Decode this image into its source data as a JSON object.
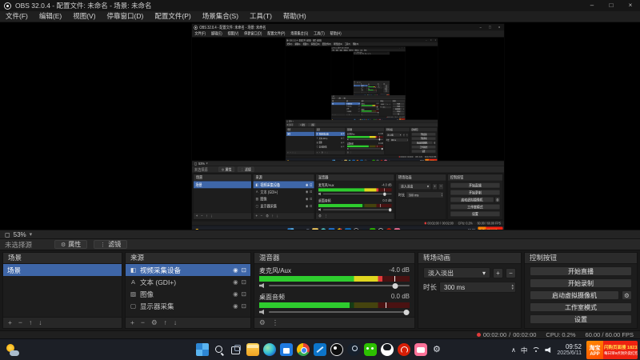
{
  "titlebar": {
    "title": "OBS 32.0.4 - 配置文件: 未命名 - 场景: 未命名"
  },
  "window_controls": {
    "minimize": "–",
    "maximize": "□",
    "close": "×"
  },
  "menu": {
    "items": [
      "文件(F)",
      "编辑(E)",
      "视图(V)",
      "停靠窗口(D)",
      "配置文件(P)",
      "场景集合(S)",
      "工具(T)",
      "帮助(H)"
    ]
  },
  "preview": {
    "zoom": "53%"
  },
  "context_bar": {
    "status": "未选择源",
    "properties": "属性",
    "filters": "滤镜"
  },
  "docks": {
    "scenes": {
      "title": "场景",
      "items": [
        {
          "label": "场景"
        }
      ]
    },
    "sources": {
      "title": "来源",
      "items": [
        {
          "icon": "◧",
          "label": "视频采集设备"
        },
        {
          "icon": "A",
          "label": "文本 (GDI+)"
        },
        {
          "icon": "▨",
          "label": "图像"
        },
        {
          "icon": "▢",
          "label": "显示器采集"
        }
      ]
    },
    "mixer": {
      "title": "混音器",
      "channels": [
        {
          "name": "麦克风/Aux",
          "db": "-4.0 dB",
          "meter_percent": 82,
          "peak_percent": 90,
          "slider_percent": 90
        },
        {
          "name": "桌面音频",
          "db": "0.0 dB",
          "meter_percent": 60,
          "peak_percent": 84,
          "slider_percent": 98
        }
      ]
    },
    "transitions": {
      "title": "转场动画",
      "selected": "淡入淡出",
      "duration_label": "时长",
      "duration_value": "300 ms"
    },
    "controls": {
      "title": "控制按钮",
      "buttons": [
        "开始直播",
        "开始录制",
        "启动虚拟摄像机",
        "工作室模式",
        "设置"
      ]
    }
  },
  "statusbar": {
    "stream_time": "00:02:00",
    "sep": "/",
    "rec_time": "00:02:00",
    "cpu": "CPU: 0.2%",
    "fps": "60.00 / 60.00 FPS"
  },
  "taskbar": {
    "input_indicator": "中",
    "time": "09:52",
    "date": "2025/6/11",
    "icons": [
      "start",
      "search",
      "task-view",
      "file-explorer",
      "edge",
      "store",
      "chrome",
      "vscode",
      "obs",
      "steam",
      "wechat",
      "qq",
      "netease-music",
      "bilibili",
      "settings"
    ]
  },
  "ad": {
    "brand_top": "淘宝",
    "brand_bottom": "APP",
    "line1": "闪购页面搜 18233",
    "line2": "每日早9点领外卖红包"
  },
  "icons": {
    "add": "+",
    "remove": "−",
    "up": "↑",
    "down": "↓",
    "gear": "⚙",
    "dots": "⋮",
    "caret": "▾",
    "eye": "◉",
    "lock": "⊡",
    "chevron_up": "∧",
    "spin_up": "▴",
    "spin_down": "▾",
    "zoom_box": "◻"
  },
  "colors": {
    "selection_blue": "#3e66a8",
    "meter_green": "#2ecc2e",
    "meter_yellow": "#e0d61f",
    "meter_red": "#e03a3a",
    "ad_orange": "#ff5a00",
    "ad_red": "#ee2211",
    "taskbar_bg": "#1c1f26"
  }
}
